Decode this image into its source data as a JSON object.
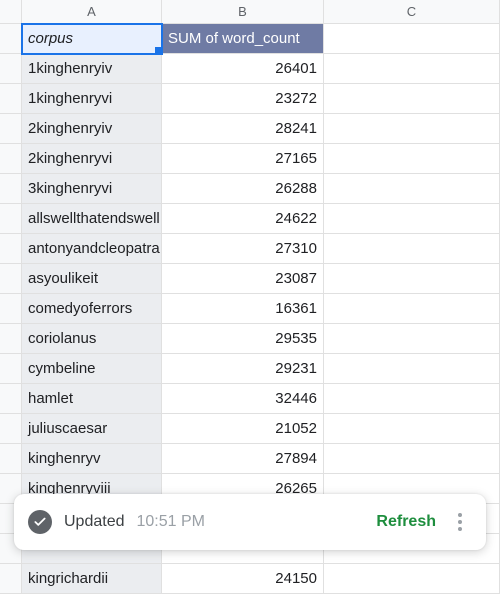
{
  "columns": {
    "A": "A",
    "B": "B",
    "C": "C"
  },
  "headers": {
    "corpus": "corpus",
    "sum": "SUM of word_count"
  },
  "rows": [
    {
      "corpus": "1kinghenryiv",
      "value": 26401
    },
    {
      "corpus": "1kinghenryvi",
      "value": 23272
    },
    {
      "corpus": "2kinghenryiv",
      "value": 28241
    },
    {
      "corpus": "2kinghenryvi",
      "value": 27165
    },
    {
      "corpus": "3kinghenryvi",
      "value": 26288
    },
    {
      "corpus": "allswellthatendswell",
      "value": 24622
    },
    {
      "corpus": "antonyandcleopatra",
      "value": 27310
    },
    {
      "corpus": "asyoulikeit",
      "value": 23087
    },
    {
      "corpus": "comedyoferrors",
      "value": 16361
    },
    {
      "corpus": "coriolanus",
      "value": 29535
    },
    {
      "corpus": "cymbeline",
      "value": 29231
    },
    {
      "corpus": "hamlet",
      "value": 32446
    },
    {
      "corpus": "juliuscaesar",
      "value": 21052
    },
    {
      "corpus": "kinghenryv",
      "value": 27894
    },
    {
      "corpus": "kinghenryviii",
      "value": 26265
    },
    {
      "corpus": "",
      "value": ""
    },
    {
      "corpus": "",
      "value": ""
    },
    {
      "corpus": "kingrichardii",
      "value": 24150
    }
  ],
  "toast": {
    "status": "Updated",
    "time": "10:51 PM",
    "refresh": "Refresh"
  }
}
